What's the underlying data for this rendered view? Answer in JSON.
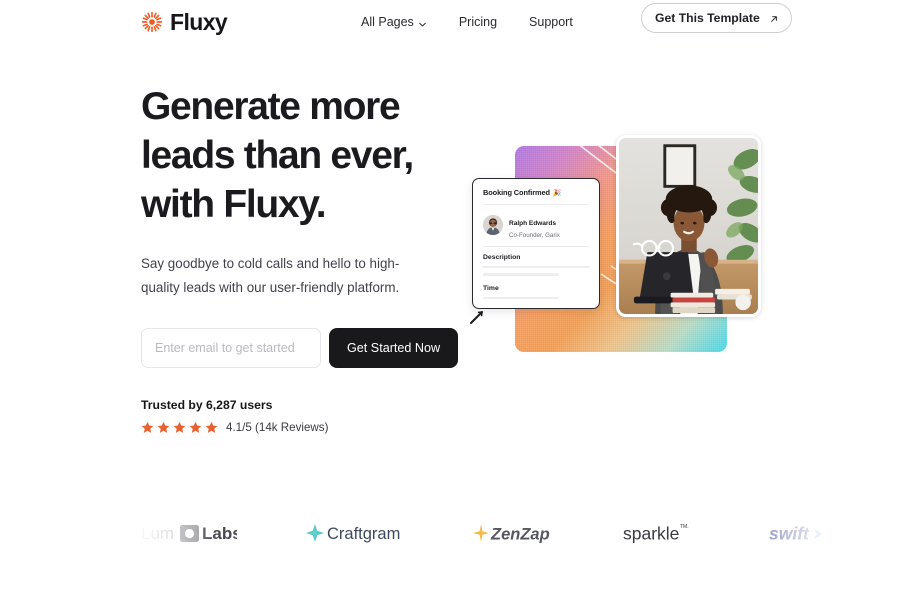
{
  "brand": {
    "name": "Fluxy",
    "mark_icon": "starburst-icon",
    "accent_color": "#ED5B24"
  },
  "nav": {
    "items": [
      {
        "label": "All Pages",
        "has_dropdown": true,
        "icon": "chevron-down-icon"
      },
      {
        "label": "Pricing",
        "has_dropdown": false
      },
      {
        "label": "Support",
        "has_dropdown": false
      }
    ],
    "cta": {
      "label": "Get This Template",
      "icon": "arrow-up-right-icon"
    }
  },
  "hero": {
    "title": "Generate more\nleads than ever,\nwith Fluxy.",
    "subtitle": "Say goodbye to cold calls and hello to high-quality leads with our user-friendly platform.",
    "form": {
      "email_placeholder": "Enter email to get started",
      "email_value": "",
      "submit_label": "Get Started Now"
    },
    "social_proof": {
      "trusted_text": "Trusted by 6,287 users",
      "stars_filled": 5,
      "stars_total": 5,
      "star_color": "#E8602B",
      "rating_text": "4.1/5 (14k Reviews)"
    }
  },
  "visual": {
    "booking_card": {
      "title": "Booking Confirmed",
      "title_emoji": "🎉",
      "person_name": "Ralph Edwards",
      "person_role": "Co-Founder, Garix",
      "description_label": "Description",
      "time_label": "Time",
      "avatar_icon": "user-avatar"
    },
    "photo_alt": "woman-at-laptop-photo",
    "cursor_icon": "cursor-arrow-icon",
    "gradient_colors": [
      "#B07CE0",
      "#F4A164",
      "#4FD8E8"
    ]
  },
  "logo_strip": {
    "logos": [
      {
        "name": "Lum Labs",
        "id": "lumlabs-logo"
      },
      {
        "name": "Craftgram",
        "id": "craftgram-logo"
      },
      {
        "name": "ZenZap",
        "id": "zenzap-logo"
      },
      {
        "name": "sparkle",
        "id": "sparkle-logo",
        "suffix": "TM."
      },
      {
        "name": "swift",
        "id": "swift-logo"
      },
      {
        "name": "Lu",
        "id": "lumlabs-logo-partial"
      }
    ]
  }
}
